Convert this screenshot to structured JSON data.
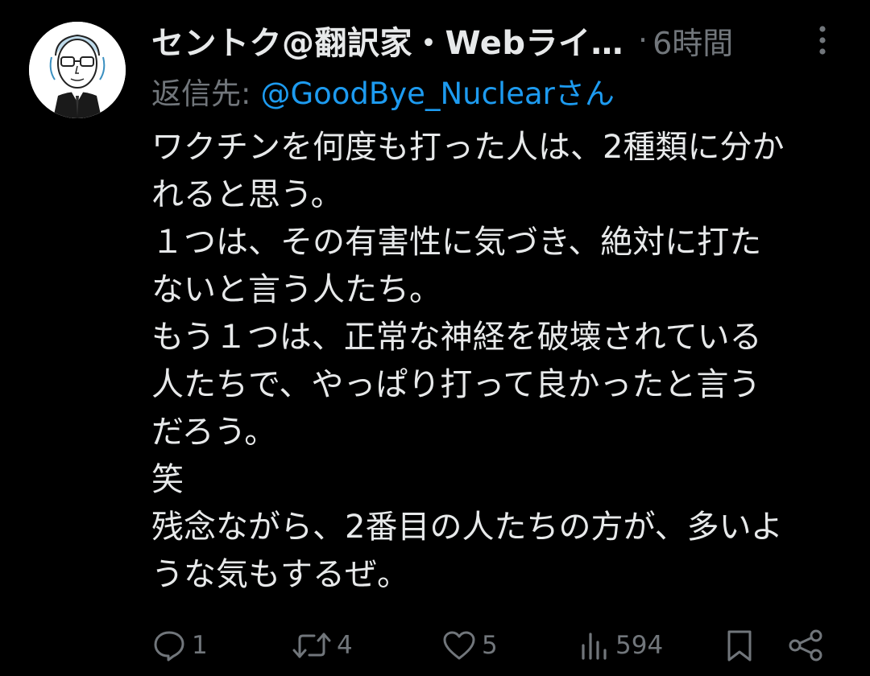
{
  "tweet": {
    "avatar_icon": "illustrated-portrait-avatar",
    "display_name": "セントク@翻訳家・Webライ…",
    "separator": "·",
    "timestamp": "6時間",
    "more_icon": "more-vertical-icon",
    "reply_label": "返信先:",
    "reply_handle": "@GoodBye_Nuclearさん",
    "lines": [
      "ワクチンを何度も打った人は、2種類に分か",
      "れると思う。",
      "１つは、その有害性に気づき、絶対に打た",
      "ないと言う人たち。",
      "もう１つは、正常な神経を破壊されている",
      "人たちで、やっぱり打って良かったと言う",
      "だろう。",
      "笑",
      "残念ながら、2番目の人たちの方が、多いよ",
      "うな気もするぜ。"
    ]
  },
  "actions": {
    "replies": "1",
    "retweets": "4",
    "likes": "5",
    "views": "594",
    "reply_icon": "reply-icon",
    "retweet_icon": "retweet-icon",
    "like_icon": "heart-icon",
    "views_icon": "views-chart-icon",
    "bookmark_icon": "bookmark-icon",
    "share_icon": "share-icon"
  },
  "colors": {
    "background": "#000000",
    "primary_text": "#e7e9ea",
    "secondary_text": "#71767b",
    "link": "#1d9bf0"
  }
}
